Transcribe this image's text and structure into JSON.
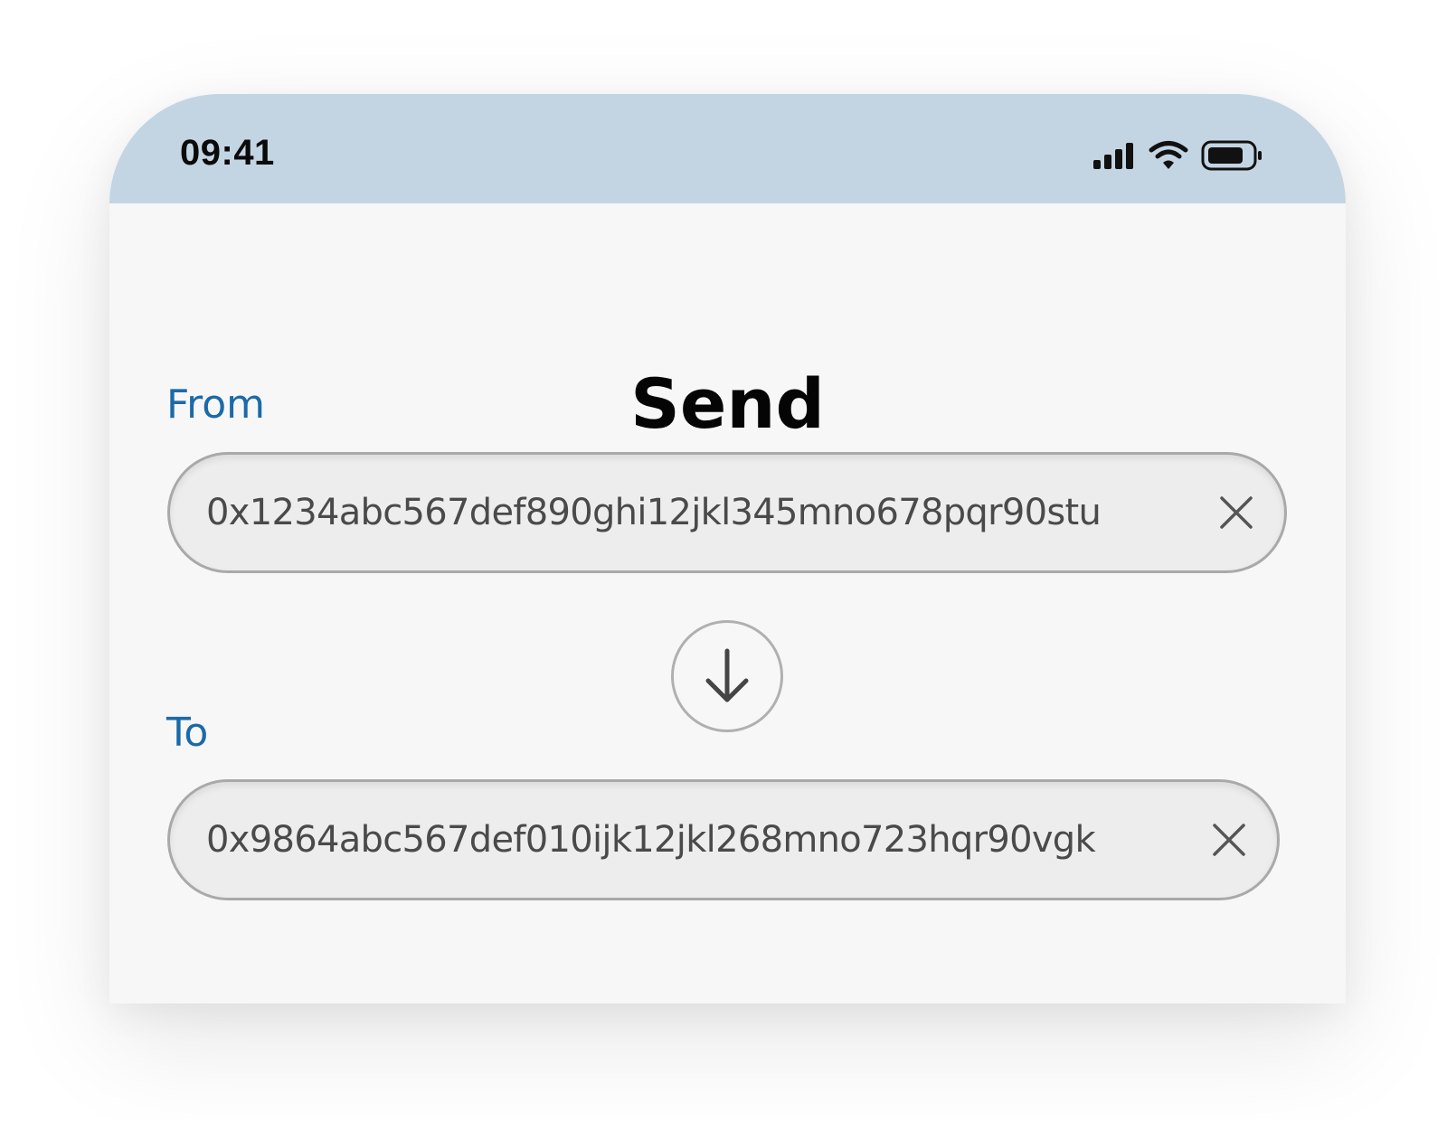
{
  "status_bar": {
    "time": "09:41",
    "icons": [
      "cellular-signal-icon",
      "wifi-icon",
      "battery-icon"
    ]
  },
  "page": {
    "title": "Send"
  },
  "from": {
    "label": "From",
    "value": "0x1234abc567def890ghi12jkl345mno678pqr90stu",
    "clear_icon": "close-icon"
  },
  "swap": {
    "icon": "arrow-down-icon"
  },
  "to": {
    "label": "To",
    "value": "0x9864abc567def010ijk12jkl268mno723hqr90vgk",
    "clear_icon": "close-icon"
  },
  "colors": {
    "status_bar_bg": "#c3d5e3",
    "label_blue": "#1b6aa8",
    "screen_bg": "#f7f7f7",
    "field_bg": "#ededed",
    "field_border": "#a9a9a9"
  }
}
